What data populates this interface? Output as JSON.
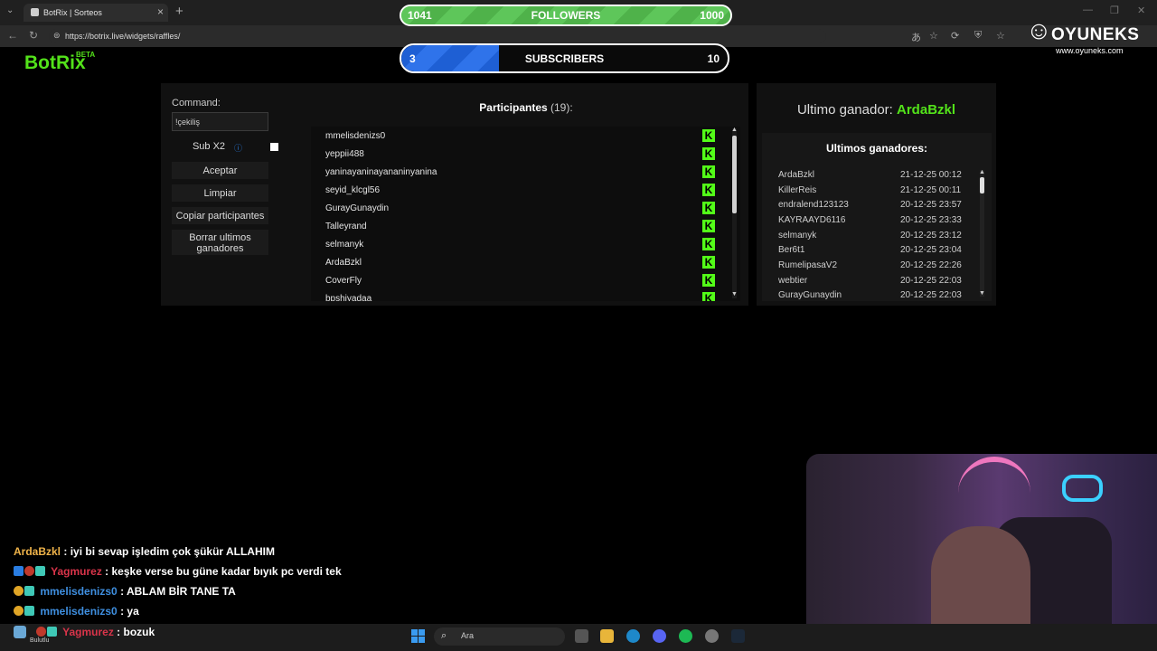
{
  "browser": {
    "tab_title": "BotRix | Sorteos",
    "url": "https://botrix.live/widgets/raffles/",
    "window_controls": [
      "—",
      "❐",
      "✕"
    ]
  },
  "brand": {
    "name": "BotRix",
    "beta": "BETA"
  },
  "overlay": {
    "followers": {
      "label": "FOLLOWERS",
      "current": "1041",
      "goal": "1000",
      "progress": 1.0
    },
    "subscribers": {
      "label": "SUBSCRIBERS",
      "current": "3",
      "goal": "10",
      "progress": 0.3
    },
    "logo": {
      "name": "OYUNEKS",
      "site": "www.oyuneks.com"
    }
  },
  "controls": {
    "command_label": "Command:",
    "command_value": "!çekiliş",
    "subx2_label": "Sub X2",
    "subx2_info": "ⓘ",
    "accept": "Aceptar",
    "clear": "Limpiar",
    "copy": "Copiar participantes",
    "delete_winners": "Borrar ultimos ganadores"
  },
  "participants": {
    "title": "Participantes",
    "count": "(19):",
    "items": [
      "mmelisdenizs0",
      "yeppii488",
      "yaninayaninayananinyanina",
      "seyid_klcgl56",
      "GurayGunaydin",
      "Talleyrand",
      "selmanyk",
      "ArdaBzkl",
      "CoverFly",
      "bpshiyadaa"
    ]
  },
  "winners": {
    "last_label": "Ultimo ganador:",
    "last_name": "ArdaBzkl",
    "list_title": "Ultimos ganadores:",
    "items": [
      {
        "name": "ArdaBzkl",
        "date": "21-12-25 00:12"
      },
      {
        "name": "KillerReis",
        "date": "21-12-25 00:11"
      },
      {
        "name": "endralend123123",
        "date": "20-12-25 23:57"
      },
      {
        "name": "KAYRAAYD6116",
        "date": "20-12-25 23:33"
      },
      {
        "name": "selmanyk",
        "date": "20-12-25 23:12"
      },
      {
        "name": "Ber6t1",
        "date": "20-12-25 23:04"
      },
      {
        "name": "RumelipasaV2",
        "date": "20-12-25 22:26"
      },
      {
        "name": "webtier",
        "date": "20-12-25 22:03"
      },
      {
        "name": "GurayGunaydin",
        "date": "20-12-25 22:03"
      }
    ]
  },
  "chat": [
    {
      "user": "ArdaBzkl",
      "message": ": iyi bi sevap işledim çok şükür ALLAHIM"
    },
    {
      "user": "Yagmurez",
      "message": ": keşke verse bu güne kadar bıyık pc verdi tek"
    },
    {
      "user": "mmelisdenizs0",
      "message": ": ABLAM BİR TANE TA"
    },
    {
      "user": "mmelisdenizs0",
      "message": ": ya"
    },
    {
      "user": "Yagmurez",
      "message": ": bozuk"
    }
  ],
  "taskbar": {
    "weather": "Bulutlu",
    "search_placeholder": "Ara"
  },
  "colors": {
    "brand_green": "#53e21a",
    "kick_green": "#53fc18",
    "followers_bar": "#5ec65a",
    "subs_bar": "#2f73ea"
  }
}
